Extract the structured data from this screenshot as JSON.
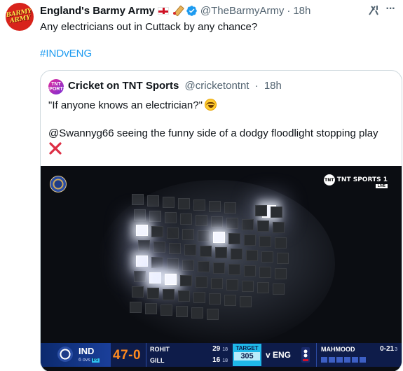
{
  "tweet": {
    "avatar_text": "BARMY ARMY",
    "display_name": "England's Barmy Army",
    "handle": "@TheBarmyArmy",
    "separator": "·",
    "time": "18h",
    "text": "Any electricians out in Cuttack by any chance?",
    "hashtag": "#INDvENG",
    "icons": [
      "england-flag-icon",
      "cricket-bat-icon",
      "verified-badge-icon",
      "grok-icon",
      "more-icon"
    ]
  },
  "quote": {
    "avatar_text": "TNT SPORTS",
    "display_name": "Cricket on TNT Sports",
    "handle": "@cricketontnt",
    "separator": "·",
    "time": "18h",
    "line1": "\"If anyone knows an electrician?\"",
    "line2": "@Swannyg66 seeing the funny side of a dodgy floodlight stopping play",
    "icons": [
      "rolling-laughing-emoji-icon",
      "cross-mark-icon"
    ]
  },
  "video": {
    "broadcaster": "TNT SPORTS 1",
    "broadcaster_badge": "LIVE",
    "scoreboard": {
      "team": "IND",
      "overs": "6 ovs",
      "powerplay": "P1",
      "total": "47-0",
      "batters": [
        {
          "name": "ROHIT",
          "runs": "29",
          "balls": "18"
        },
        {
          "name": "GILL",
          "runs": "16",
          "balls": "18"
        }
      ],
      "target_label": "TARGET",
      "target_value": "305",
      "opponent": "v ENG",
      "bowler": "MAHMOOD",
      "bowler_figures": "0-21",
      "bowler_overs": "3"
    },
    "colors": {
      "scoreboard_bg": "#0e1c4a",
      "total_color": "#ff8a1f",
      "target_bg": "#1fb8e8"
    }
  }
}
